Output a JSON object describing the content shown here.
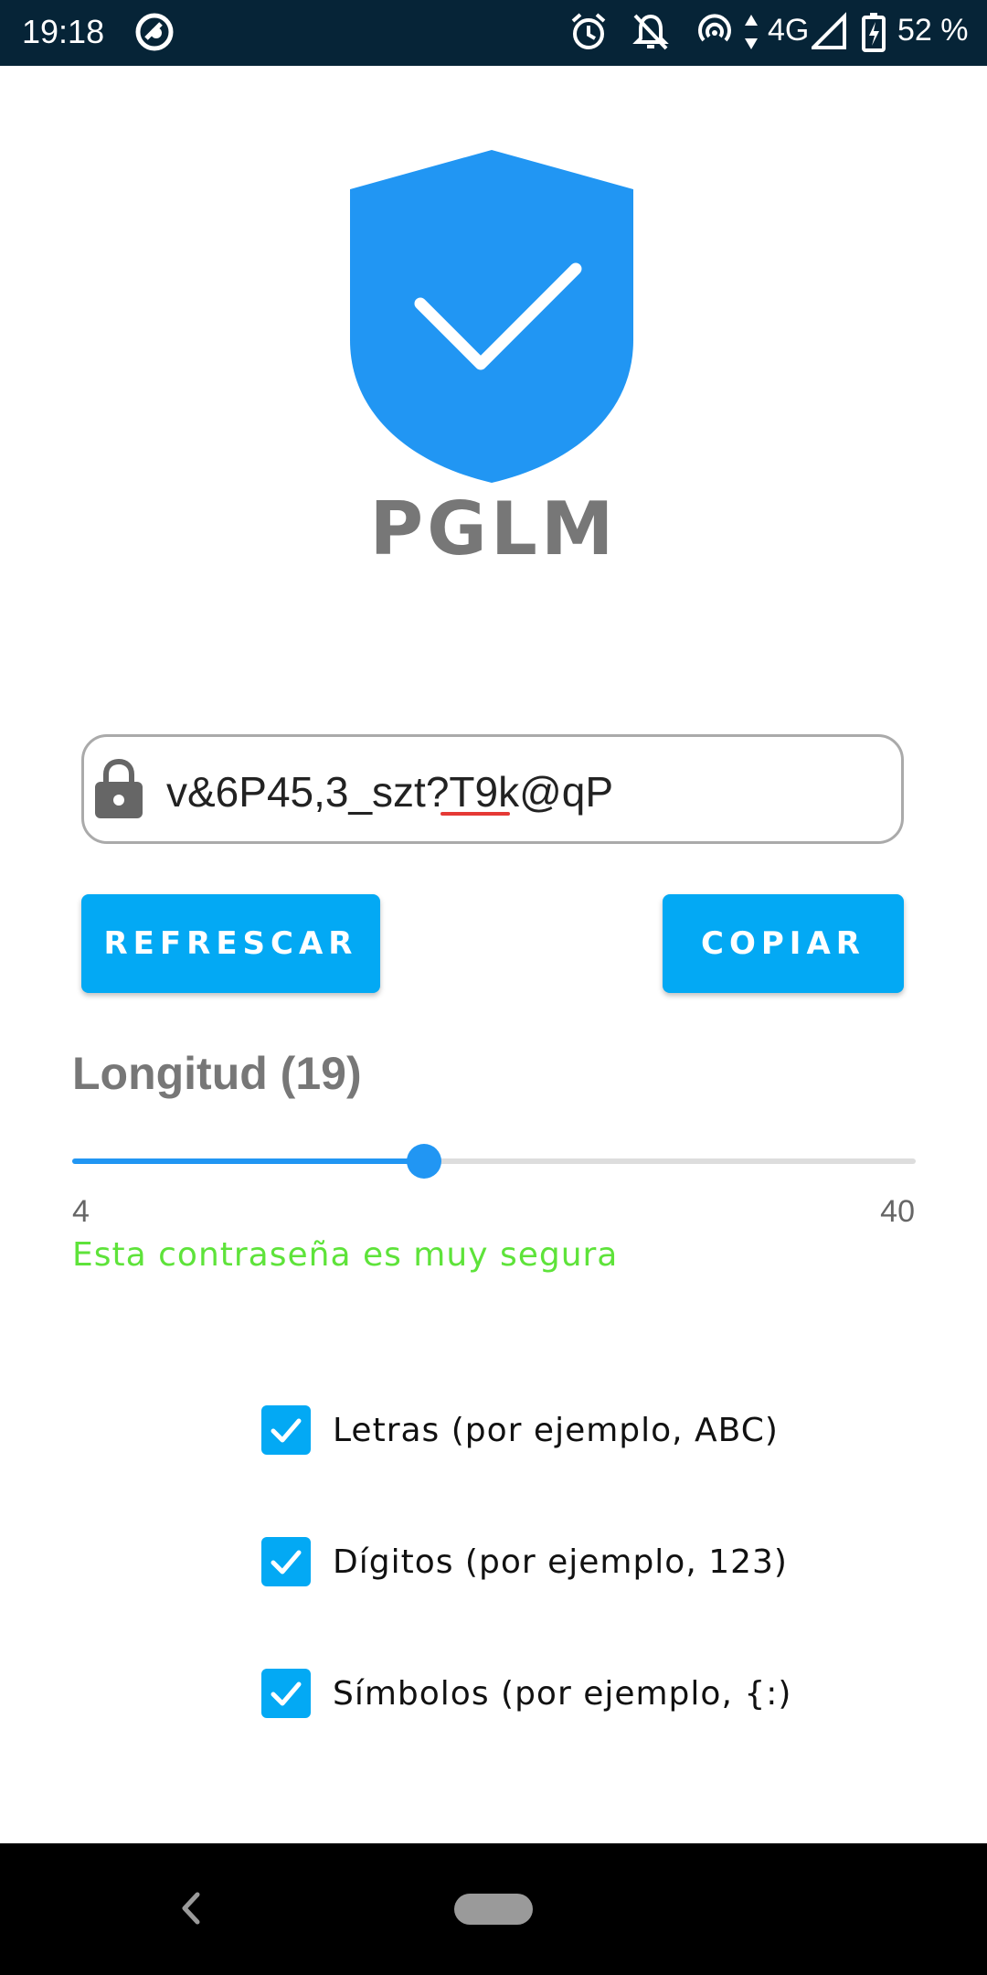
{
  "status_bar": {
    "time": "19:18",
    "network": "4G",
    "battery": "52 %",
    "icons": [
      "app-notification-icon",
      "alarm-icon",
      "do-not-disturb-icon",
      "hotspot-icon",
      "data-arrows-icon",
      "signal-icon",
      "battery-charging-icon"
    ]
  },
  "app": {
    "title": "PGLM",
    "logo": "shield-check-icon",
    "accent_color": "#2196F3",
    "button_color": "#03A9F4"
  },
  "password": {
    "value": "v&6P45,3_szt?T9k@qP"
  },
  "buttons": {
    "refresh_label": "REFRESCAR",
    "copy_label": "COPIAR"
  },
  "length": {
    "label": "Longitud (19)",
    "value": 19,
    "min": 4,
    "max": 40,
    "min_label": "4",
    "max_label": "40"
  },
  "strength": {
    "text": "Esta contraseña es muy segura",
    "color": "#5ee33a"
  },
  "options": [
    {
      "label": "Letras (por ejemplo, ABC)",
      "checked": true
    },
    {
      "label": "Dígitos (por ejemplo, 123)",
      "checked": true
    },
    {
      "label": "Símbolos (por ejemplo, {:)",
      "checked": true
    }
  ]
}
